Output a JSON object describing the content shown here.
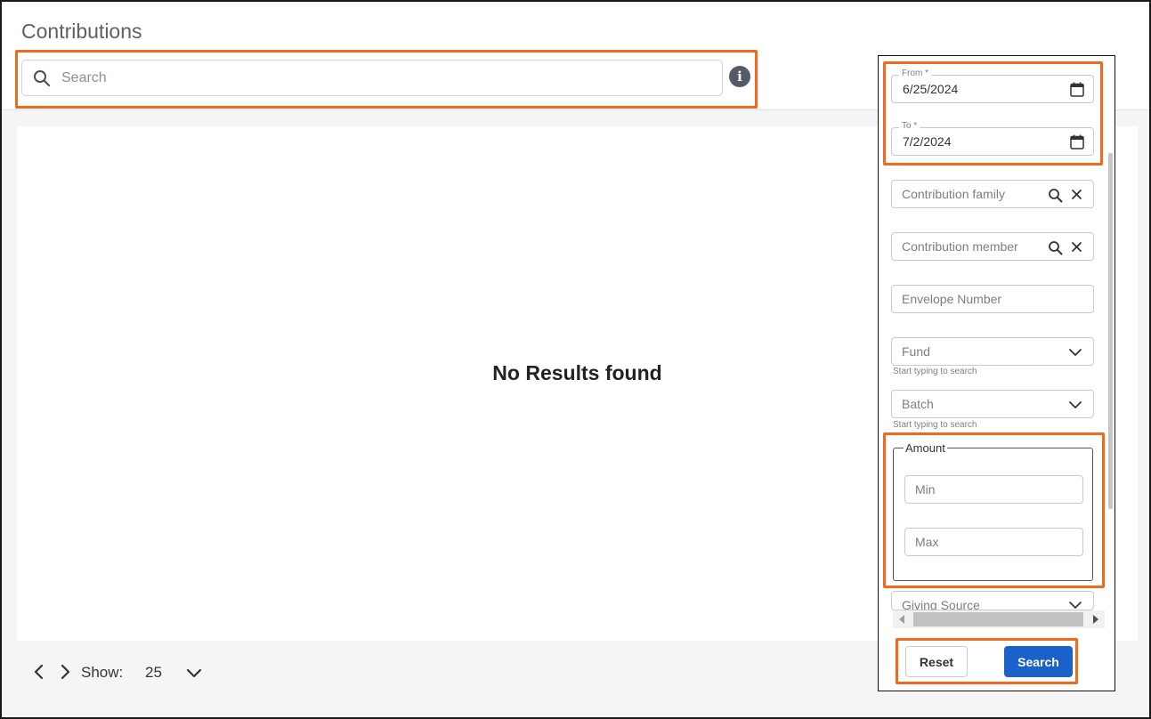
{
  "page": {
    "title": "Contributions"
  },
  "search": {
    "placeholder": "Search",
    "value": ""
  },
  "results": {
    "empty_message": "No Results found"
  },
  "pagination": {
    "show_label": "Show:",
    "page_size": "25"
  },
  "filters": {
    "from": {
      "label": "From *",
      "value": "6/25/2024"
    },
    "to": {
      "label": "To *",
      "value": "7/2/2024"
    },
    "contribution_family": {
      "placeholder": "Contribution family"
    },
    "contribution_member": {
      "placeholder": "Contribution member"
    },
    "envelope_number": {
      "placeholder": "Envelope Number"
    },
    "fund": {
      "placeholder": "Fund",
      "helper": "Start typing to search"
    },
    "batch": {
      "placeholder": "Batch",
      "helper": "Start typing to search"
    },
    "amount": {
      "legend": "Amount",
      "min_placeholder": "Min",
      "max_placeholder": "Max"
    },
    "giving_source": {
      "placeholder": "Giving Source"
    },
    "reset_label": "Reset",
    "search_label": "Search"
  },
  "colors": {
    "highlight": "#f06a1d",
    "primary_button": "#1a62c9",
    "page_background": "#f5f5f7"
  }
}
